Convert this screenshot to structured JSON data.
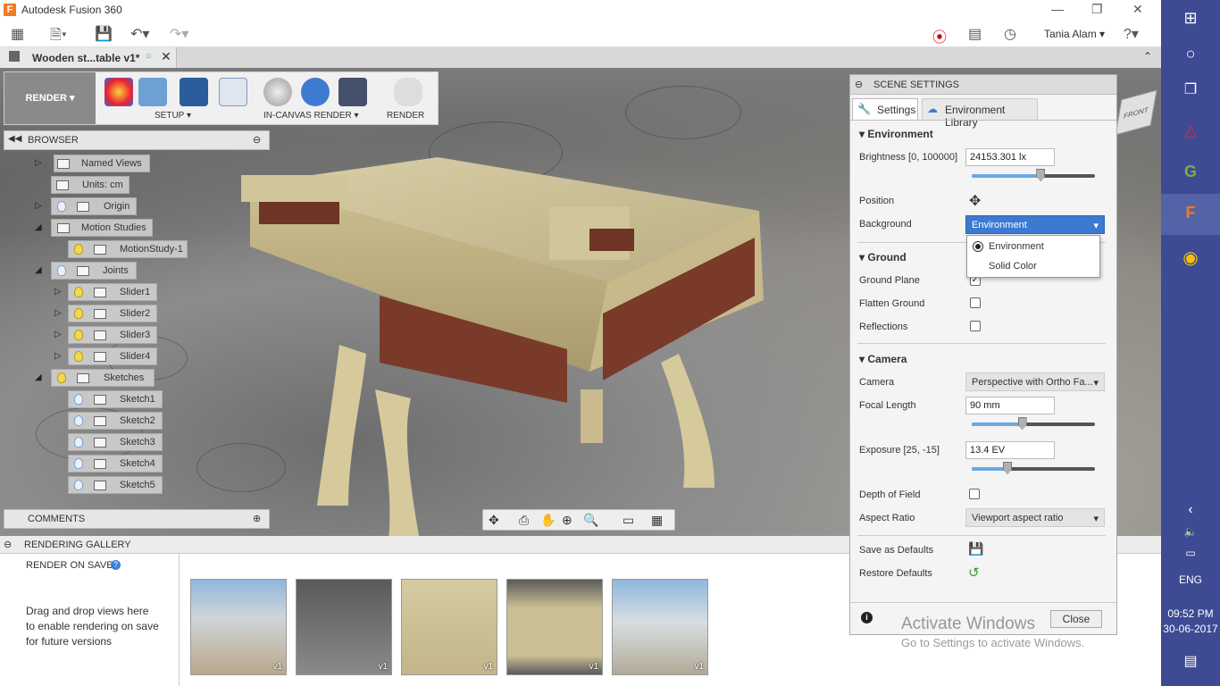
{
  "titlebar": {
    "title": "Autodesk Fusion 360",
    "controls": [
      "—",
      "❐",
      "✕"
    ]
  },
  "toolbar": {
    "user": "Tania Alam",
    "help": "?"
  },
  "doctab": {
    "title": "Wooden st...table v1*"
  },
  "ribbon": {
    "workspace": "RENDER ▾",
    "setup": "SETUP ▾",
    "incanvas": "IN-CANVAS RENDER ▾",
    "render": "RENDER"
  },
  "browser": {
    "title": "BROWSER",
    "items": [
      {
        "label": "Named Views"
      },
      {
        "label": "Units: cm"
      },
      {
        "label": "Origin"
      },
      {
        "label": "Motion Studies"
      },
      {
        "label": "MotionStudy-1"
      },
      {
        "label": "Joints"
      },
      {
        "label": "Slider1"
      },
      {
        "label": "Slider2"
      },
      {
        "label": "Slider3"
      },
      {
        "label": "Slider4"
      },
      {
        "label": "Sketches"
      },
      {
        "label": "Sketch1"
      },
      {
        "label": "Sketch2"
      },
      {
        "label": "Sketch3"
      },
      {
        "label": "Sketch4"
      },
      {
        "label": "Sketch5"
      }
    ]
  },
  "comments": {
    "title": "COMMENTS"
  },
  "gallery": {
    "title": "RENDERING GALLERY",
    "render_on_save": "RENDER ON SAVE",
    "hint": "Drag and drop views here to enable rendering on save for future versions",
    "thumbs": [
      "v1",
      "v1",
      "v1",
      "v1",
      "v1"
    ]
  },
  "scene": {
    "title": "SCENE SETTINGS",
    "tabs": [
      "Settings",
      "Environment Library"
    ],
    "environment": {
      "header": "Environment",
      "brightness_label": "Brightness [0, 100000]",
      "brightness": "24153.301 lx",
      "brightness_level": 0.56,
      "position_label": "Position",
      "background_label": "Background",
      "background": "Environment"
    },
    "dropdown": [
      "Environment",
      "Solid Color"
    ],
    "ground": {
      "header": "Ground",
      "plane": "Ground Plane",
      "flatten": "Flatten Ground",
      "reflections": "Reflections"
    },
    "camera": {
      "header": "Camera",
      "camera_label": "Camera",
      "camera": "Perspective with Ortho Fa...",
      "focal_label": "Focal Length",
      "focal": "90 mm",
      "focal_level": 0.41,
      "exposure_label": "Exposure [25, -15]",
      "exposure": "13.4 EV",
      "exposure_level": 0.29,
      "dof": "Depth of Field",
      "aspect_label": "Aspect Ratio",
      "aspect": "Viewport aspect ratio"
    },
    "save_defaults": "Save as Defaults",
    "restore_defaults": "Restore Defaults",
    "close": "Close"
  },
  "watermark": {
    "line1": "Activate Windows",
    "line2": "Go to Settings to activate Windows."
  },
  "taskbar": {
    "lang": "ENG",
    "time": "09:52 PM",
    "date": "30-06-2017"
  },
  "viewcube": {
    "label": "FRONT"
  }
}
